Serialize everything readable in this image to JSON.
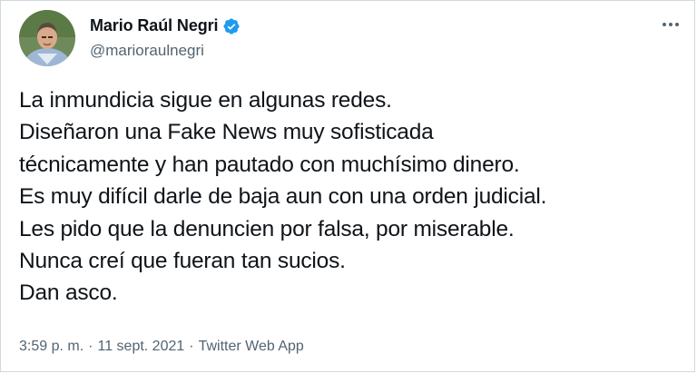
{
  "author": {
    "display_name": "Mario Raúl Negri",
    "handle": "@marioraulnegri",
    "verified": true
  },
  "tweet": {
    "lines": [
      "La inmundicia sigue en algunas redes.",
      "Diseñaron una Fake News muy sofisticada",
      "técnicamente y han pautado con muchísimo dinero.",
      "Es muy difícil darle de baja aun con una orden judicial.",
      "Les pido que la denuncien por falsa, por miserable.",
      "Nunca creí que fueran tan sucios.",
      "Dan asco."
    ]
  },
  "meta": {
    "time": "3:59 p. m.",
    "separator": "·",
    "date": "11 sept. 2021",
    "source": "Twitter Web App"
  },
  "colors": {
    "verified_blue": "#1d9bf0",
    "secondary_text": "#536471",
    "primary_text": "#0f1419"
  },
  "icons": {
    "verified": "verified-badge-icon",
    "more": "more-options-icon"
  }
}
